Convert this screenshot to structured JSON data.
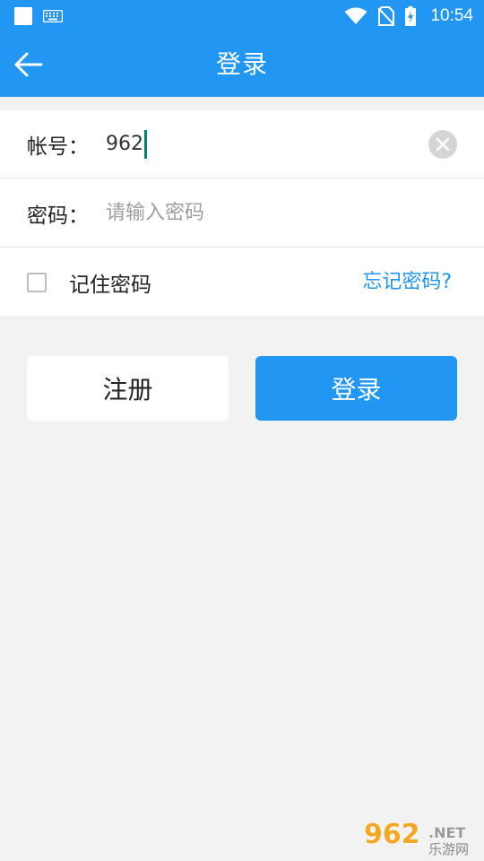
{
  "status_bar": {
    "time": "10:54",
    "icons": [
      "square-icon",
      "keyboard-icon",
      "wifi-icon",
      "no-sim-icon",
      "battery-charging-icon"
    ]
  },
  "app_bar": {
    "title": "登录",
    "back_icon": "arrow-left-icon"
  },
  "form": {
    "account": {
      "label": "帐号：",
      "value": "962",
      "clear_icon": "clear-circle-icon"
    },
    "password": {
      "label": "密码：",
      "placeholder": "请输入密码",
      "value": ""
    },
    "remember": {
      "label": "记住密码",
      "checked": false
    },
    "forgot_label": "忘记密码?"
  },
  "buttons": {
    "register_label": "注册",
    "login_label": "登录"
  },
  "watermark": {
    "brand": "962",
    "suffix": ".NET",
    "tagline": "乐游网"
  },
  "colors": {
    "primary": "#2196f3",
    "background": "#f2f2f2",
    "caret": "#008577"
  }
}
